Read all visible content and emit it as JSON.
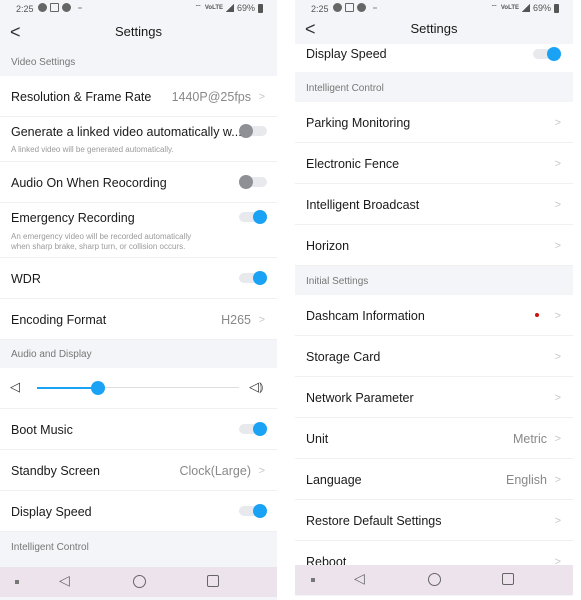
{
  "status_bar": {
    "time": "2:25",
    "network": "VoLTE",
    "battery": "69%"
  },
  "header": {
    "title": "Settings",
    "back_icon": "chevron-left-icon"
  },
  "colors": {
    "accent": "#1aa3f5",
    "toggle_off": "#8e9096",
    "badge": "#cc1111",
    "nav_bar": "#ede3ec",
    "background": "#f4f5f8"
  },
  "left": {
    "sections": {
      "video": "Video Settings",
      "audio_display": "Audio and Display",
      "intelligent": "Intelligent Control"
    },
    "rows": {
      "resolution": {
        "label": "Resolution & Frame Rate",
        "value": "1440P@25fps"
      },
      "linked_video": {
        "label": "Generate a linked video automatically w...",
        "sub": "A linked video will be generated automatically.",
        "on": false
      },
      "audio_on": {
        "label": "Audio On When Reocording",
        "on": false
      },
      "emergency": {
        "label": "Emergency Recording",
        "sub1": "An emergency video will be recorded automatically",
        "sub2": "when sharp brake, sharp turn, or collision occurs.",
        "on": true
      },
      "wdr": {
        "label": "WDR",
        "on": true
      },
      "encoding": {
        "label": "Encoding Format",
        "value": "H265"
      },
      "volume": {
        "level": 0.3
      },
      "boot_music": {
        "label": "Boot Music",
        "on": true
      },
      "standby": {
        "label": "Standby Screen",
        "value": "Clock(Large)"
      },
      "display_speed": {
        "label": "Display Speed",
        "on": true
      }
    }
  },
  "right": {
    "sections": {
      "intelligent": "Intelligent Control",
      "initial": "Initial Settings"
    },
    "rows": {
      "display_speed": {
        "label": "Display Speed",
        "on": true
      },
      "parking": {
        "label": "Parking Monitoring"
      },
      "fence": {
        "label": "Electronic Fence"
      },
      "broadcast": {
        "label": "Intelligent Broadcast"
      },
      "horizon": {
        "label": "Horizon"
      },
      "dashcam_info": {
        "label": "Dashcam Information",
        "has_badge": true
      },
      "storage": {
        "label": "Storage Card"
      },
      "network": {
        "label": "Network Parameter"
      },
      "unit": {
        "label": "Unit",
        "value": "Metric"
      },
      "language": {
        "label": "Language",
        "value": "English"
      },
      "restore": {
        "label": "Restore Default Settings"
      },
      "reboot": {
        "label": "Reboot"
      }
    }
  },
  "glyphs": {
    "chevron": ">",
    "back": "<",
    "nav_back": "◁",
    "vol_low": "🔈",
    "vol_high": "🔊"
  }
}
